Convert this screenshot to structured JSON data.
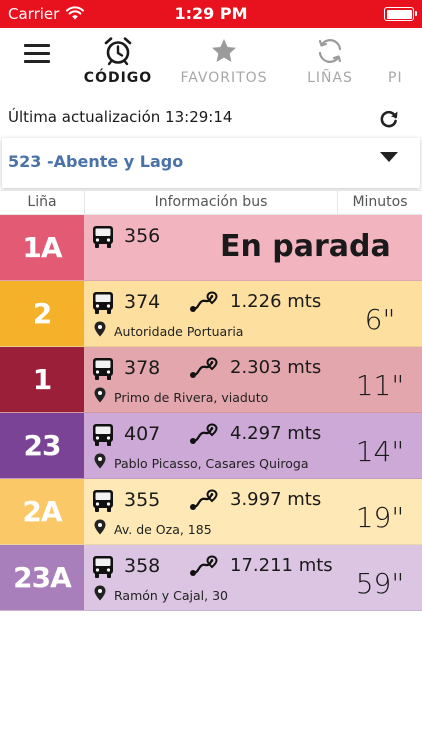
{
  "status_bar": {
    "carrier": "Carrier",
    "time": "1:29 PM"
  },
  "nav": {
    "tabs": [
      {
        "label": "CÓDIGO",
        "icon": "alarm-clock-icon",
        "active": true
      },
      {
        "label": "FAVORITOS",
        "icon": "star-icon",
        "active": false
      },
      {
        "label": "LIÑAS",
        "icon": "refresh-circle-icon",
        "active": false
      },
      {
        "label": "PI",
        "icon": "",
        "active": false
      }
    ]
  },
  "update": {
    "text": "Última actualización 13:29:14"
  },
  "stop": {
    "number": "523",
    "name": "-Abente y Lago"
  },
  "table": {
    "headers": {
      "line": "Liña",
      "info": "Información bus",
      "minutes": "Minutos"
    },
    "rows": [
      {
        "line": "1A",
        "line_color": "#e35a74",
        "row_color": "#f2b5c0",
        "bus": "356",
        "status": "En parada"
      },
      {
        "line": "2",
        "line_color": "#f6b12a",
        "row_color": "#fde0a0",
        "bus": "374",
        "distance": "1.226 mts",
        "stop": "Autoridade Portuaria",
        "minutes": "6\""
      },
      {
        "line": "1",
        "line_color": "#9c1f3a",
        "row_color": "#e3a6ad",
        "bus": "378",
        "distance": "2.303 mts",
        "stop": "Primo de Rivera, viaduto",
        "minutes": "11\""
      },
      {
        "line": "23",
        "line_color": "#7b4396",
        "row_color": "#cca9d6",
        "bus": "407",
        "distance": "4.297 mts",
        "stop": "Pablo Picasso, Casares Quiroga",
        "minutes": "14\""
      },
      {
        "line": "2A",
        "line_color": "#fac866",
        "row_color": "#fde8b6",
        "bus": "355",
        "distance": "3.997 mts",
        "stop": "Av. de Oza, 185",
        "minutes": "19\""
      },
      {
        "line": "23A",
        "line_color": "#a87fbb",
        "row_color": "#dbc5e3",
        "bus": "358",
        "distance": "17.211 mts",
        "stop": "Ramón y Cajal, 30",
        "minutes": "59\""
      }
    ]
  }
}
